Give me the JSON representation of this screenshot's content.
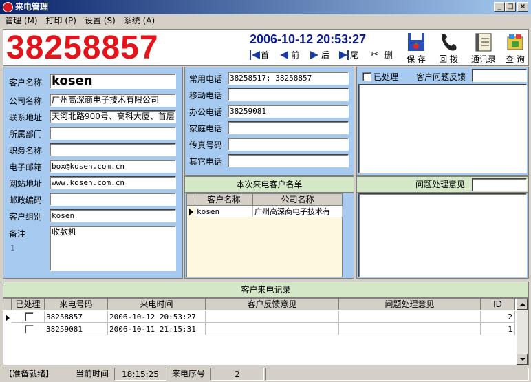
{
  "window": {
    "title": "来电管理"
  },
  "menu": [
    "管理 (M)",
    "打印 (P)",
    "设置 (S)",
    "系统 (A)"
  ],
  "caller": {
    "number": "38258857",
    "datetime": "2006-10-12 20:53:27"
  },
  "nav": {
    "first": "首",
    "prev": "前",
    "next": "后",
    "last": "尾",
    "delete": "删"
  },
  "toolbar": {
    "save": "保 存",
    "callback": "回 拨",
    "contacts": "通讯录",
    "search": "查 询"
  },
  "customer": {
    "labels": {
      "name": "客户名称",
      "company": "公司名称",
      "address": "联系地址",
      "dept": "所属部门",
      "title": "职务名称",
      "email": "电子邮箱",
      "website": "网站地址",
      "zip": "邮政编码",
      "group": "客户组别",
      "note": "备注"
    },
    "name": "kosen",
    "company": "广州高深商电子技术有限公司",
    "address": "天河北路900号、高科大厦、首层",
    "dept": "",
    "title": "",
    "email": "box@kosen.com.cn",
    "website": "www.kosen.com.cn",
    "zip": "",
    "group": "kosen",
    "note": "收款机",
    "note_index": "1"
  },
  "phones": {
    "labels": {
      "common": "常用电话",
      "mobile": "移动电话",
      "office": "办公电话",
      "home": "家庭电话",
      "fax": "传真号码",
      "other": "其它电话"
    },
    "common": "38258517; 38258857",
    "mobile": "",
    "office": "38259081",
    "home": "",
    "fax": "",
    "other": ""
  },
  "feedback": {
    "processed_label": "已处理",
    "feedback_label": "客户问题反馈",
    "feedback_value": "",
    "opinion_label": "问题处理意见",
    "opinion_value": ""
  },
  "call_customers": {
    "title": "本次来电客户名单",
    "columns": [
      "客户名称",
      "公司名称"
    ],
    "rows": [
      [
        "kosen",
        "广州高深商电子技术有"
      ]
    ]
  },
  "call_log": {
    "title": "客户来电记录",
    "columns": [
      "已处理",
      "来电号码",
      "来电时间",
      "客户反馈意见",
      "问题处理意见",
      "ID"
    ],
    "rows": [
      {
        "number": "38258857",
        "time": "2006-10-12 20:53:27",
        "feedback": "",
        "opinion": "",
        "id": "2"
      },
      {
        "number": "38259081",
        "time": "2006-10-11 21:15:31",
        "feedback": "",
        "opinion": "",
        "id": "1"
      }
    ]
  },
  "status": {
    "ready": "【准备就绪】",
    "time_label": "当前时间",
    "time": "18:15:25",
    "seq_label": "来电序号",
    "seq": "2"
  }
}
